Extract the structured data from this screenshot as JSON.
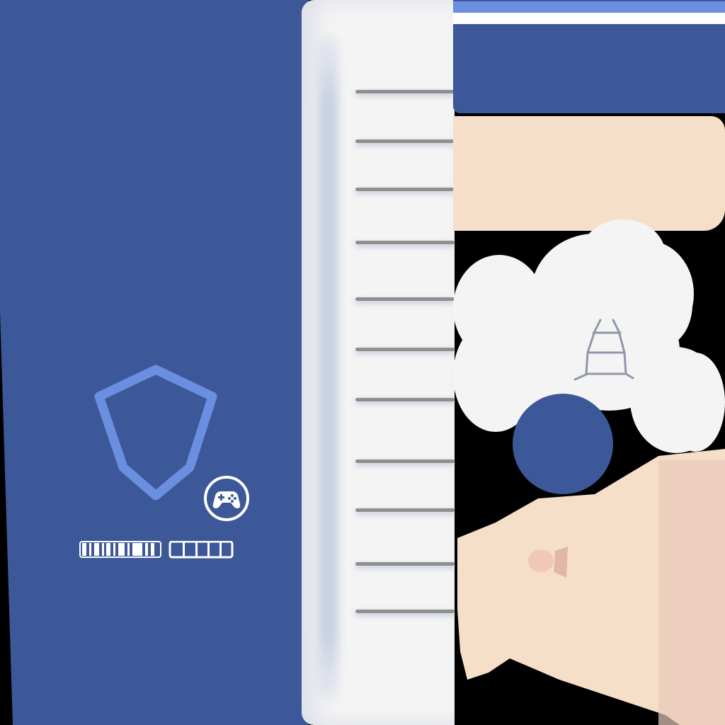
{
  "colors": {
    "panel_blue": "#3c5898",
    "accent_blue": "#6b8fe0",
    "strip_white": "#f4f4f4",
    "tick_gray": "#8f8f8f",
    "skin": "#f6dfc9",
    "skin_shadow": "#e8c9b8",
    "icon_gray": "#8f97a8"
  },
  "icons": {
    "shield": "shield-icon",
    "gamepad": "gamepad-icon",
    "code": "barcode-icon",
    "tower": "tower-icon"
  },
  "ruler": {
    "tick_count": 11
  }
}
